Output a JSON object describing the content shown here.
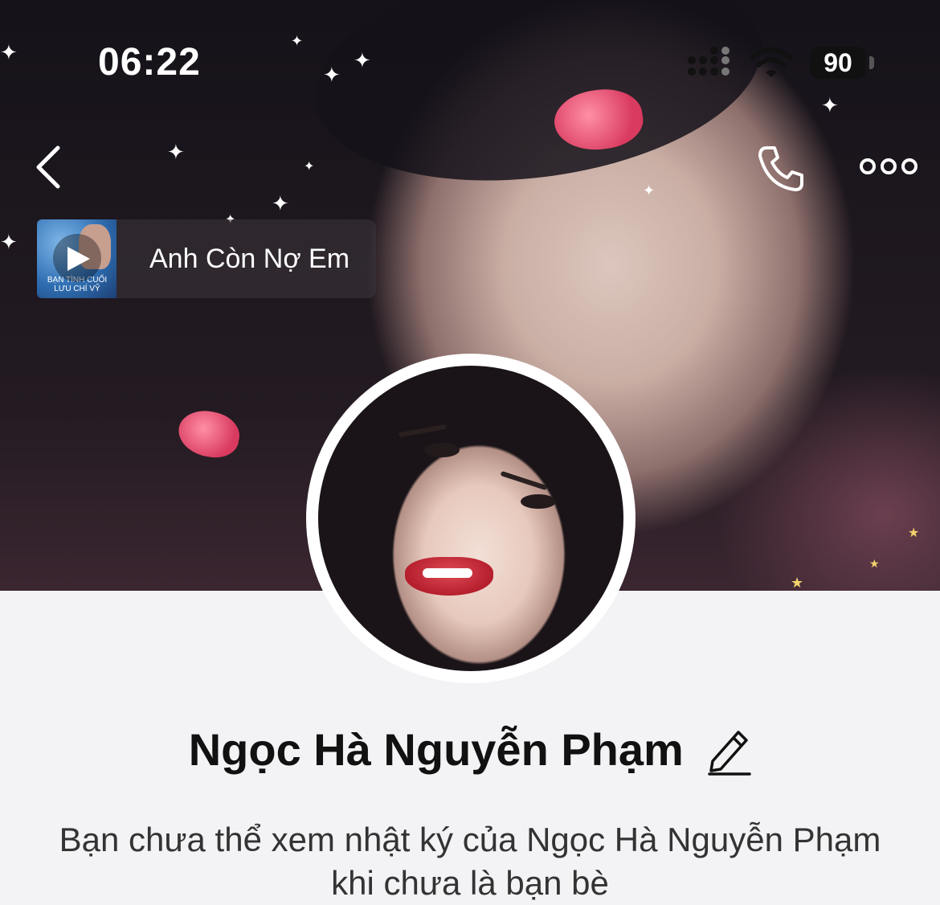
{
  "status_bar": {
    "time": "06:22",
    "battery": "90"
  },
  "music": {
    "song_title": "Anh Còn Nợ Em",
    "album_caption": "BẠN TÌNH CUỐI LƯU CHÍ VỸ"
  },
  "profile": {
    "name": "Ngọc Hà Nguyễn Phạm",
    "privacy_message": "Bạn chưa thể xem nhật ký của Ngọc Hà Nguyễn Phạm khi chưa là bạn bè"
  },
  "icons": {
    "back": "chevron-left-icon",
    "call": "phone-icon",
    "more": "more-dots-icon",
    "edit": "pencil-icon",
    "play": "play-icon"
  },
  "colors": {
    "background": "#f3f3f5",
    "text_primary": "#111111",
    "text_secondary": "#333333"
  }
}
